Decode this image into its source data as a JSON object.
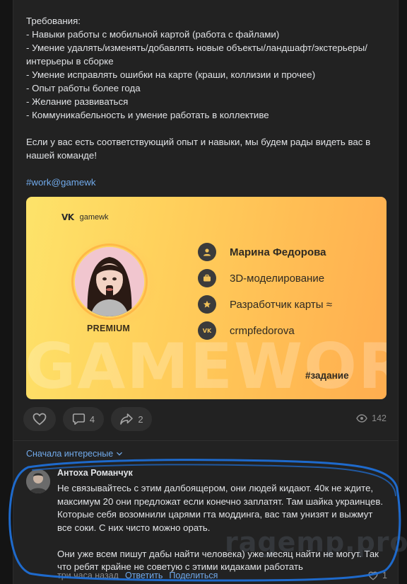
{
  "post": {
    "requirements_lines": [
      "Требования:",
      "- Навыки работы с мобильной картой (работа с файлами)",
      "- Умение удалять/изменять/добавлять новые объекты/ландшафт/экстерьеры/",
      "интерьеры в сборке",
      "- Умение исправлять ошибки на карте (краши, коллизии и прочее)",
      "- Опыт работы более года",
      "- Желание развиваться",
      "- Коммуникабельность и умение работать в коллективе"
    ],
    "closing_lines": [
      "Если у вас есть соответствующий опыт и навыки, мы будем рады видеть вас в",
      "нашей команде!"
    ],
    "hashtag": "#work@gamewk"
  },
  "banner": {
    "brand": "gamewk",
    "badge": "PREMIUM",
    "name": "Марина Федорова",
    "skill": "3D-моделирование",
    "role": "Разработчик карты ≈",
    "contact": "crmpfedorova",
    "bg_word": "GAMEWORK",
    "tag": "#задание",
    "colors": {
      "gradient_start": "#fde36a",
      "gradient_end": "#ffad4f",
      "icon_bg": "#3b3b3b"
    },
    "icons": [
      "user-icon",
      "briefcase-icon",
      "star-icon",
      "vk-icon"
    ]
  },
  "actions": {
    "like_count": "",
    "comments_count": "4",
    "share_count": "2",
    "views_count": "142"
  },
  "comments_section": {
    "sort_label": "Сначала интересные"
  },
  "comment": {
    "author": "Антоха Романчук",
    "text_paragraphs": [
      "Не связывайтесь с этим далбоящером, они людей кидают. 40к не ждите, максимум 20 они предложат если конечно заплатят. Там шайка украинцев. Которые себя возомнили царями гта моддинга, вас там унизят и выжмут все соки. С них чисто можно орать.",
      "Они уже всем пишут дабы найти человека) уже месяц найти не могут. Так что ребят крайне не советую с этими кидаками работать"
    ],
    "time": "три часа назад",
    "reply_label": "Ответить",
    "share_label": "Поделиться",
    "likes": "1"
  },
  "watermark": "ragemp.pro",
  "theme": {
    "link_color": "#71aaeb",
    "annotation_color": "#1f6fd6"
  }
}
